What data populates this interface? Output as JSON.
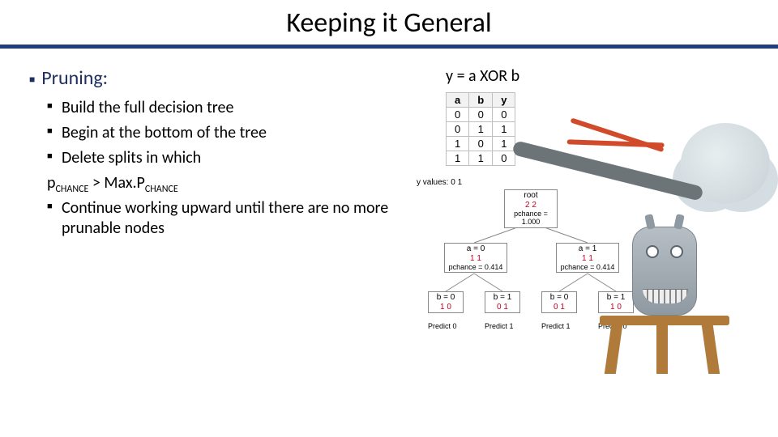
{
  "slide": {
    "title": "Keeping it General",
    "heading": "Pruning:",
    "bullets": {
      "b1": "Build the full decision tree",
      "b2": "Begin at the bottom of the tree",
      "b3": "Delete splits in which",
      "b4": "Continue working upward until there are no more prunable nodes"
    },
    "formula": {
      "p": "p",
      "sub1": "CHANCE",
      "gt": " > Max.P",
      "sub2": "CHANCE"
    }
  },
  "right": {
    "equation": "y = a XOR b"
  },
  "truth_table": {
    "headers": [
      "a",
      "b",
      "y"
    ],
    "rows": [
      [
        "0",
        "0",
        "0"
      ],
      [
        "0",
        "1",
        "1"
      ],
      [
        "1",
        "0",
        "1"
      ],
      [
        "1",
        "1",
        "0"
      ]
    ]
  },
  "tree": {
    "yvalues": "y values: 0 1",
    "root": {
      "label": "root",
      "count": "2 2",
      "pch": "pchance = 1.000"
    },
    "a0": {
      "label": "a = 0",
      "count": "1 1",
      "pch": "pchance = 0.414"
    },
    "a1": {
      "label": "a = 1",
      "count": "1 1",
      "pch": "pchance = 0.414"
    },
    "l1": {
      "label": "b = 0",
      "count": "1 0"
    },
    "l2": {
      "label": "b = 1",
      "count": "0 1"
    },
    "l3": {
      "label": "b = 0",
      "count": "0 1"
    },
    "l4": {
      "label": "b = 1",
      "count": "1 0"
    },
    "p1": "Predict 0",
    "p2": "Predict 1",
    "p3": "Predict 1",
    "p4": "Predict 0"
  }
}
